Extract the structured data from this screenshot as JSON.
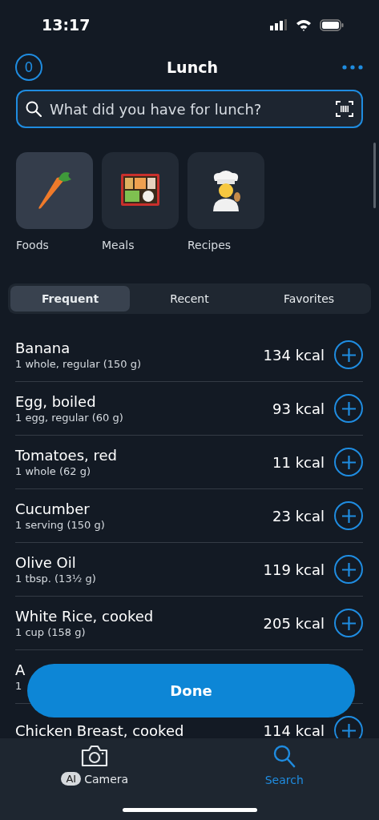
{
  "status_bar": {
    "time": "13:17"
  },
  "header": {
    "counter": "0",
    "title": "Lunch"
  },
  "search": {
    "placeholder": "What did you have for lunch?"
  },
  "categories": [
    {
      "label": "Foods",
      "kind": "carrot",
      "selected": true
    },
    {
      "label": "Meals",
      "kind": "bento",
      "selected": false
    },
    {
      "label": "Recipes",
      "kind": "cook",
      "selected": false
    }
  ],
  "tabs": [
    {
      "label": "Frequent",
      "selected": true
    },
    {
      "label": "Recent",
      "selected": false
    },
    {
      "label": "Favorites",
      "selected": false
    }
  ],
  "foods": [
    {
      "name": "Banana",
      "detail": "1 whole, regular (150 g)",
      "kcal": "134 kcal"
    },
    {
      "name": "Egg, boiled",
      "detail": "1 egg, regular (60 g)",
      "kcal": "93 kcal"
    },
    {
      "name": "Tomatoes, red",
      "detail": "1 whole (62 g)",
      "kcal": "11 kcal"
    },
    {
      "name": "Cucumber",
      "detail": "1 serving (150 g)",
      "kcal": "23 kcal"
    },
    {
      "name": "Olive Oil",
      "detail": "1 tbsp. (13½ g)",
      "kcal": "119 kcal"
    },
    {
      "name": "White Rice, cooked",
      "detail": "1 cup (158 g)",
      "kcal": "205 kcal"
    },
    {
      "name": "A",
      "detail": "1"
    },
    {
      "name": "Chicken Breast, cooked",
      "kcal": "114 kcal"
    }
  ],
  "done_button": "Done",
  "bottom_nav": [
    {
      "label": "Camera",
      "badge": "AI",
      "kind": "camera",
      "selected": false
    },
    {
      "label": "Search",
      "kind": "search",
      "selected": true
    }
  ]
}
